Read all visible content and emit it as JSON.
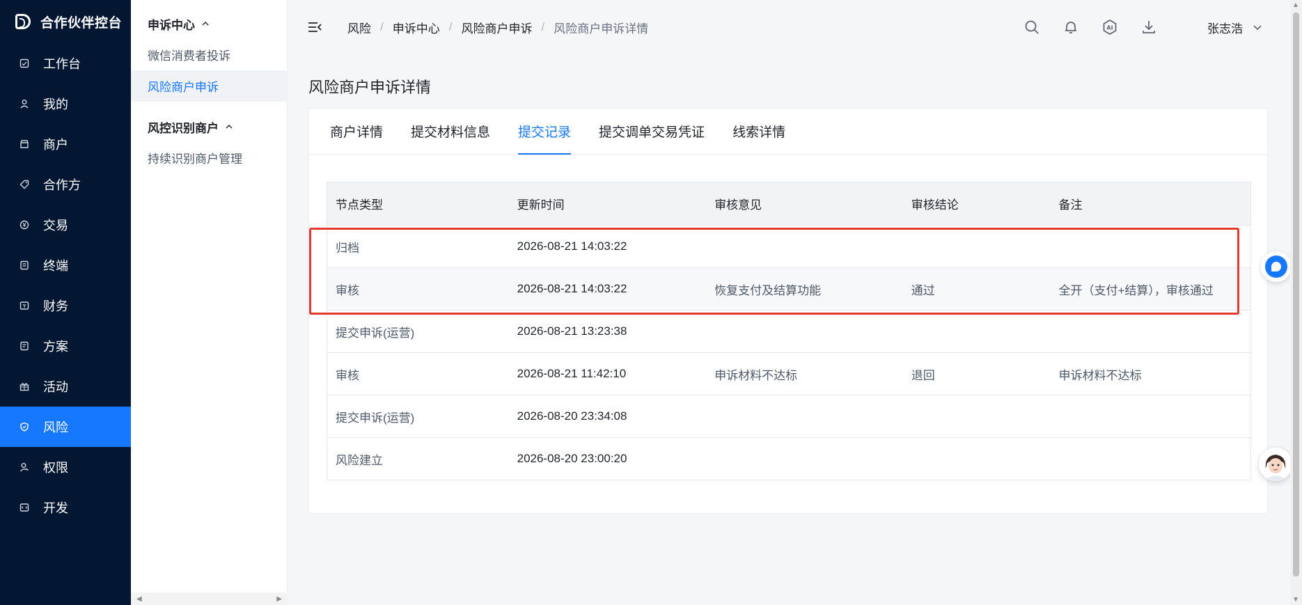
{
  "brand": {
    "title": "合作伙伴控台"
  },
  "sidebar": {
    "items": [
      {
        "label": "工作台",
        "icon": "dashboard-icon"
      },
      {
        "label": "我的",
        "icon": "user-icon"
      },
      {
        "label": "商户",
        "icon": "store-icon"
      },
      {
        "label": "合作方",
        "icon": "tag-icon"
      },
      {
        "label": "交易",
        "icon": "yuan-icon"
      },
      {
        "label": "终端",
        "icon": "terminal-icon"
      },
      {
        "label": "财务",
        "icon": "finance-icon"
      },
      {
        "label": "方案",
        "icon": "document-icon"
      },
      {
        "label": "活动",
        "icon": "gift-icon"
      },
      {
        "label": "风险",
        "icon": "shield-icon",
        "active": true
      },
      {
        "label": "权限",
        "icon": "permission-icon"
      },
      {
        "label": "开发",
        "icon": "code-icon"
      }
    ]
  },
  "submenu": {
    "group1": {
      "label": "申诉中心"
    },
    "group1_items": [
      "微信消费者投诉",
      "风险商户申诉"
    ],
    "group2": {
      "label": "风控识别商户"
    },
    "group2_items": [
      "持续识别商户管理"
    ]
  },
  "breadcrumb": [
    "风险",
    "申诉中心",
    "风险商户申诉",
    "风险商户申诉详情"
  ],
  "header": {
    "user_name": "张志浩"
  },
  "page": {
    "title": "风险商户申诉详情"
  },
  "tabs": [
    "商户详情",
    "提交材料信息",
    "提交记录",
    "提交调单交易凭证",
    "线索详情"
  ],
  "table": {
    "columns": [
      "节点类型",
      "更新时间",
      "审核意见",
      "审核结论",
      "备注"
    ],
    "rows": [
      [
        "归档",
        "2026-08-21 14:03:22",
        "",
        "",
        ""
      ],
      [
        "审核",
        "2026-08-21 14:03:22",
        "恢复支付及结算功能",
        "通过",
        "全开（支付+结算），审核通过"
      ],
      [
        "提交申诉(运营)",
        "2026-08-21 13:23:38",
        "",
        "",
        ""
      ],
      [
        "审核",
        "2026-08-21 11:42:10",
        "申诉材料不达标",
        "退回",
        "申诉材料不达标"
      ],
      [
        "提交申诉(运营)",
        "2026-08-20 23:34:08",
        "",
        "",
        ""
      ],
      [
        "风险建立",
        "2026-08-20 23:00:20",
        "",
        "",
        ""
      ]
    ]
  },
  "colors": {
    "accent": "#1677ff",
    "sidebar_bg": "#031733",
    "highlight": "#e5392f"
  }
}
